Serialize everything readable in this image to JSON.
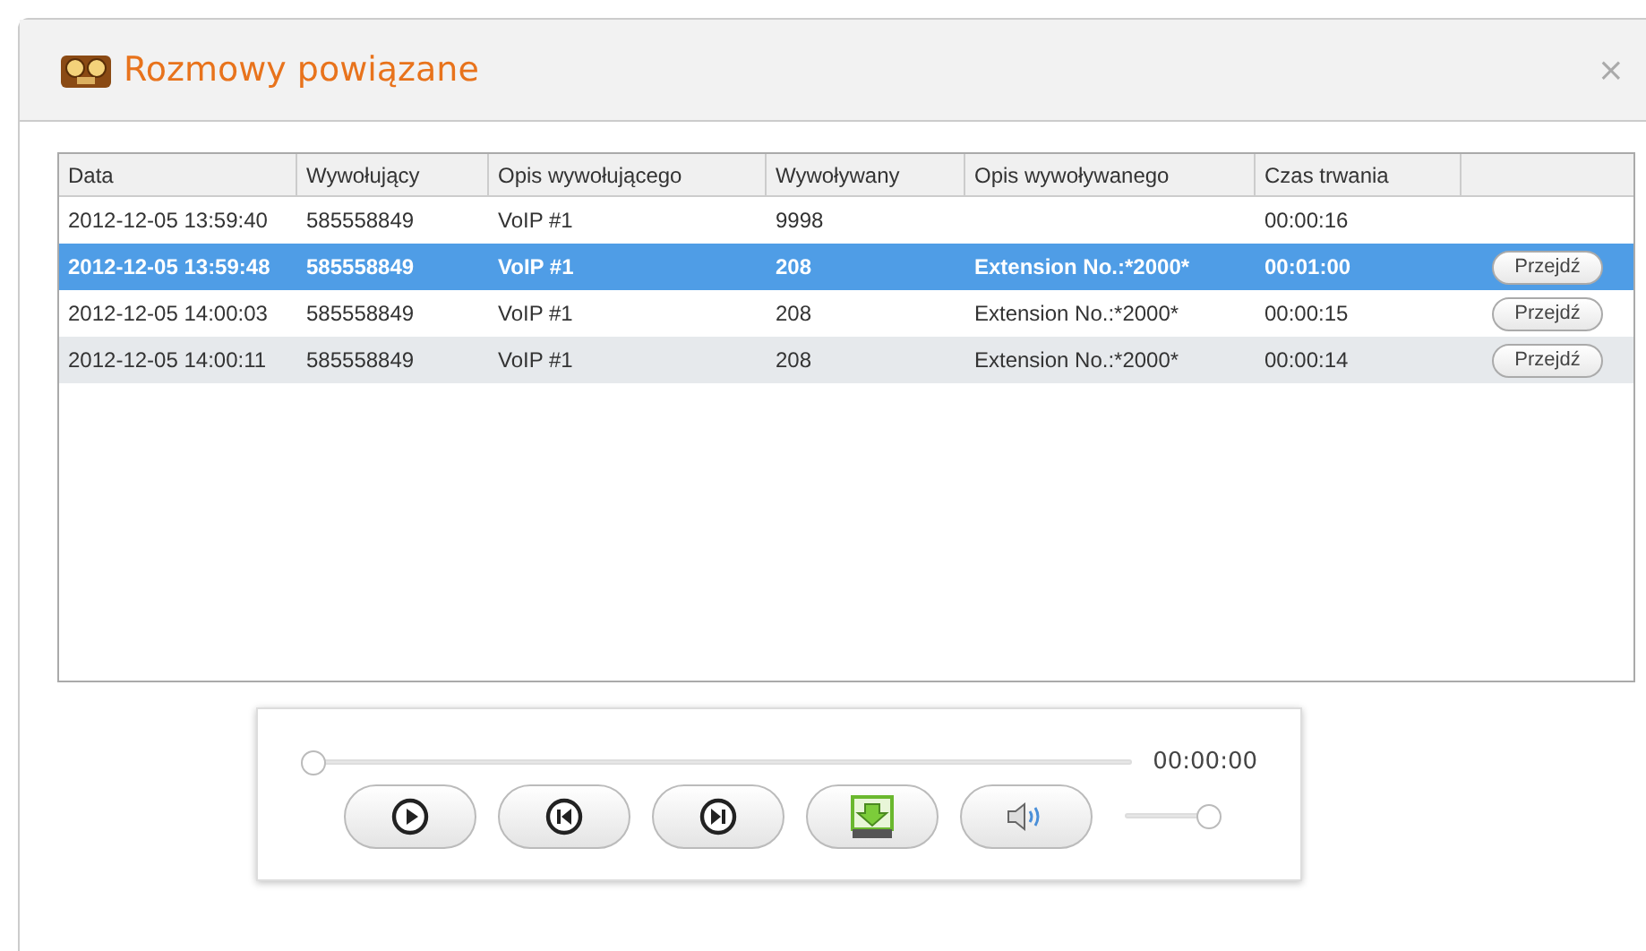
{
  "dialog": {
    "title": "Rozmowy powiązane",
    "close": "×"
  },
  "table": {
    "columns": [
      "Data",
      "Wywołujący",
      "Opis wywołującego",
      "Wywoływany",
      "Opis wywoływanego",
      "Czas trwania"
    ],
    "rows": [
      {
        "cells": [
          "2012-12-05 13:59:40",
          "585558849",
          "VoIP #1",
          "9998",
          "",
          "00:00:16"
        ],
        "selected": false
      },
      {
        "cells": [
          "2012-12-05 13:59:48",
          "585558849",
          "VoIP #1",
          "208",
          "Extension No.:*2000*",
          "00:01:00"
        ],
        "selected": true,
        "action": "Przejdź"
      },
      {
        "cells": [
          "2012-12-05 14:00:03",
          "585558849",
          "VoIP #1",
          "208",
          "Extension No.:*2000*",
          "00:00:15"
        ],
        "selected": false,
        "action": "Przejdź"
      },
      {
        "cells": [
          "2012-12-05 14:00:11",
          "585558849",
          "VoIP #1",
          "208",
          "Extension No.:*2000*",
          "00:00:14"
        ],
        "selected": false,
        "action": "Przejdź"
      }
    ]
  },
  "player": {
    "position": {
      "level": 0
    },
    "time": "00:00:00",
    "volume": {
      "level": 1
    }
  }
}
